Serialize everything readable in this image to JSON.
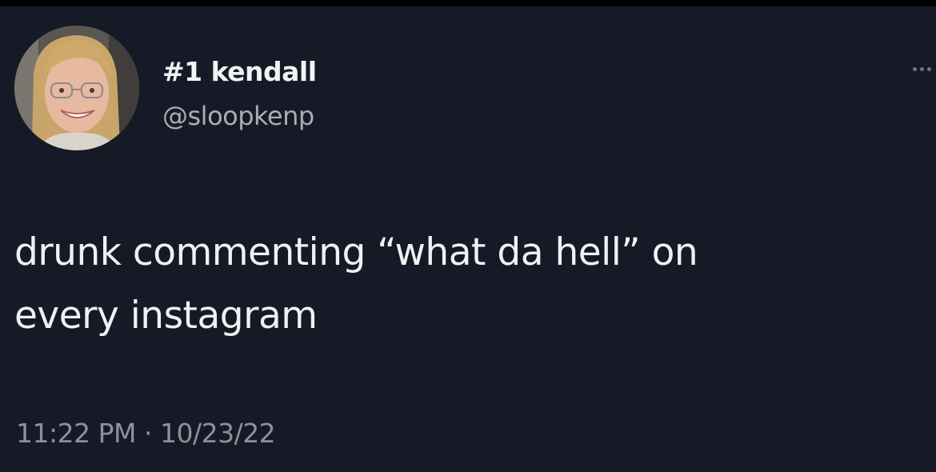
{
  "tweet": {
    "display_name": "#1 kendall",
    "handle": "@sloopkenp",
    "text": "drunk commenting “what da hell” on\nevery instagram",
    "time": "11:22 PM",
    "separator": "·",
    "date": "10/23/22"
  },
  "icons": {
    "more": "more-options-icon",
    "avatar": "profile-avatar"
  },
  "colors": {
    "background": "#151a26",
    "text_primary": "#f0f1f2",
    "text_secondary": "#a8adb5"
  }
}
